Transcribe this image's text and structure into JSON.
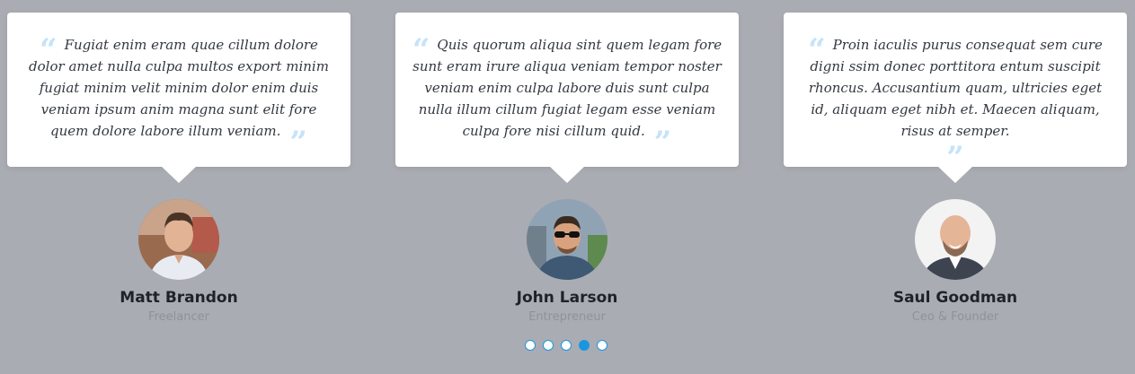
{
  "testimonials": [
    {
      "quote": "Fugiat enim eram quae cillum dolore dolor amet nulla culpa multos export minim fugiat minim velit minim dolor enim duis veniam ipsum anim magna sunt elit fore quem dolore labore illum veniam.",
      "name": "Matt Brandon",
      "role": "Freelancer"
    },
    {
      "quote": "Quis quorum aliqua sint quem legam fore sunt eram irure aliqua veniam tempor noster veniam enim culpa labore duis sunt culpa nulla illum cillum fugiat legam esse veniam culpa fore nisi cillum quid.",
      "name": "John Larson",
      "role": "Entrepreneur"
    },
    {
      "quote": "Proin iaculis purus consequat sem cure digni ssim donec porttitora entum suscipit rhoncus. Accusantium quam, ultricies eget id, aliquam eget nibh et. Maecen aliquam, risus at semper.",
      "name": "Saul Goodman",
      "role": "Ceo & Founder"
    }
  ],
  "quote_marks": {
    "open": "“",
    "close": "”"
  },
  "carousel": {
    "total_pages": 5,
    "active_page": 4
  },
  "colors": {
    "accent": "#1a96e0",
    "quote_mark": "#c6e3f8",
    "background": "#a9acb2"
  }
}
